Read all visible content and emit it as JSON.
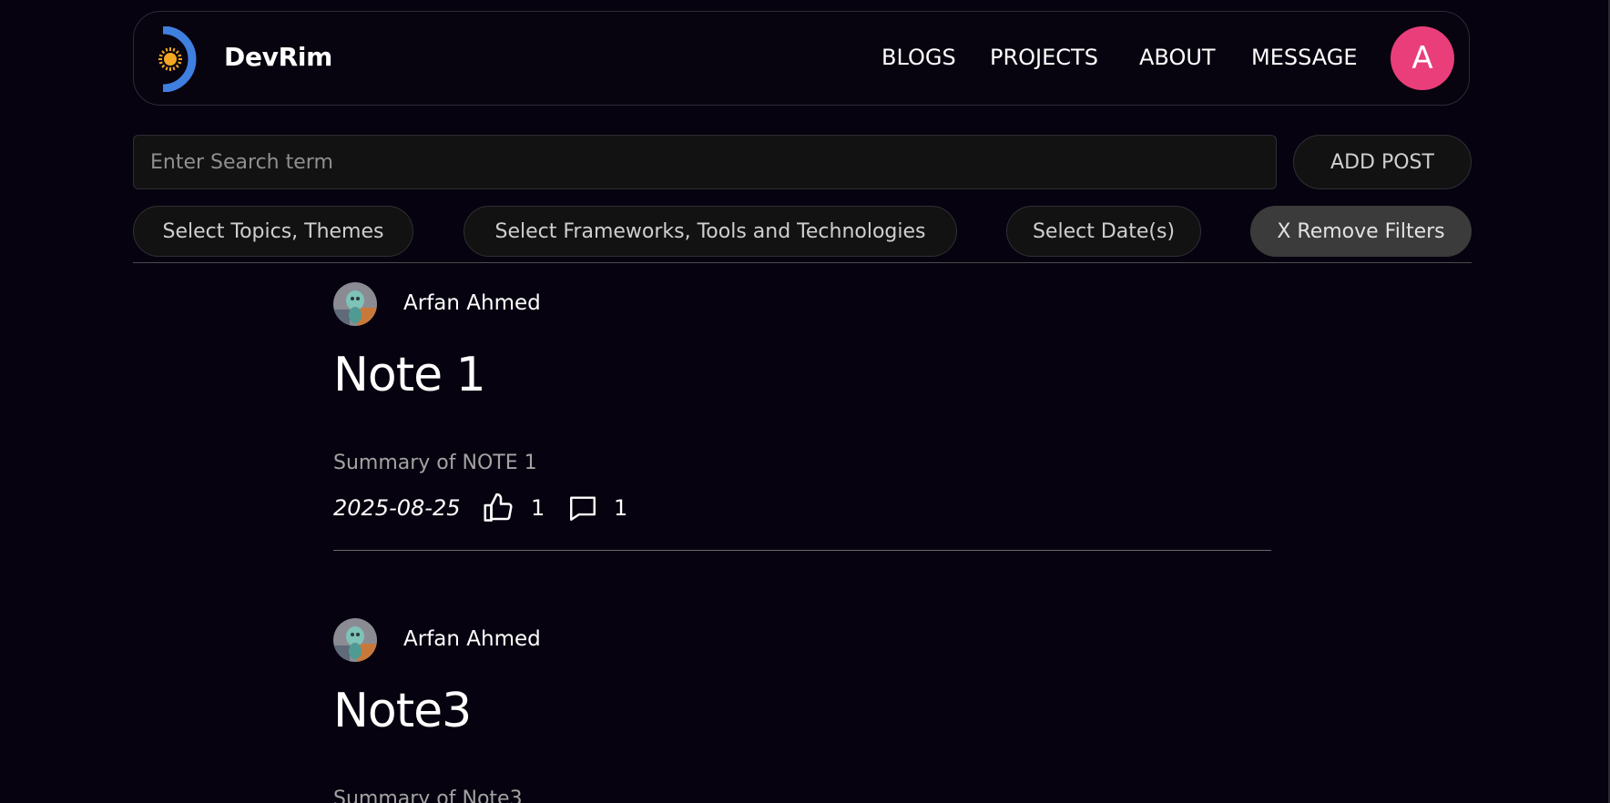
{
  "header": {
    "brand": "DevRim",
    "nav": [
      "BLOGS",
      "PROJECTS",
      "ABOUT",
      "MESSAGE"
    ],
    "avatar_letter": "A",
    "avatar_color": "#ea3e7a"
  },
  "search": {
    "placeholder": "Enter Search term",
    "value": "",
    "add_post_label": "ADD POST"
  },
  "filters": {
    "topics": "Select Topics, Themes",
    "frameworks": "Select Frameworks, Tools and Technologies",
    "dates": "Select Date(s)",
    "remove": "X Remove Filters"
  },
  "posts": [
    {
      "author": "Arfan Ahmed",
      "title": "Note 1",
      "summary": "Summary of NOTE 1",
      "date": "2025-08-25",
      "likes": "1",
      "comments": "1"
    },
    {
      "author": "Arfan Ahmed",
      "title": "Note3",
      "summary": "Summary of Note3"
    }
  ],
  "colors": {
    "background": "#06020f",
    "logo_blue": "#3f7fe0",
    "logo_sun": "#f5a623"
  }
}
